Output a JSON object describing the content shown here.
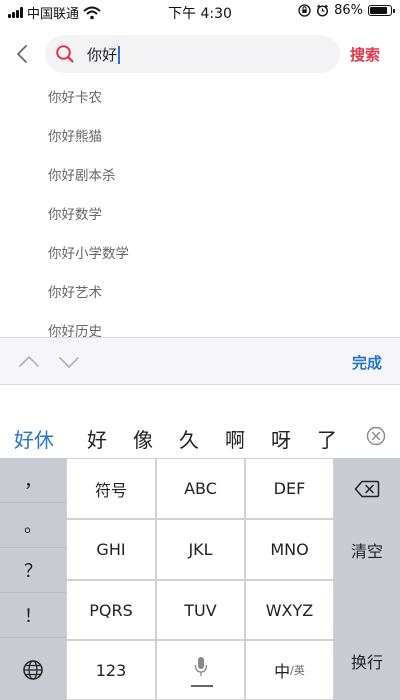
{
  "status": {
    "carrier": "中国联通",
    "time": "下午 4:30",
    "battery": "86%",
    "battery_level": 0.86
  },
  "search": {
    "query": "你好",
    "submit_label": "搜索"
  },
  "suggestions": [
    "你好卡农",
    "你好熊猫",
    "你好剧本杀",
    "你好数学",
    "你好小学数学",
    "你好艺术",
    "你好历史"
  ],
  "accessory": {
    "done_label": "完成"
  },
  "candidates": [
    "好休",
    "好",
    "像",
    "久",
    "啊",
    "呀",
    "了"
  ],
  "keyboard": {
    "symbols": [
      "，",
      "。",
      "？",
      "！"
    ],
    "rows": [
      [
        "符号",
        "ABC",
        "DEF"
      ],
      [
        "GHI",
        "JKL",
        "MNO"
      ],
      [
        "PQRS",
        "TUV",
        "WXYZ"
      ]
    ],
    "bottom": {
      "numbers": "123",
      "lang_main": "中",
      "lang_sub": "英"
    },
    "clear_label": "清空",
    "newline_label": "换行"
  },
  "colors": {
    "accent_red": "#e0364b",
    "accent_blue": "#2575c9"
  }
}
